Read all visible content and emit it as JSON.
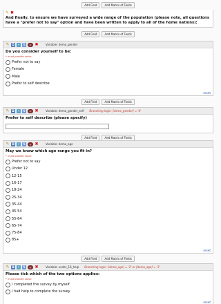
{
  "buttons": {
    "add_field": "Add Field",
    "add_matrix": "Add Matrix of Fields"
  },
  "intro": {
    "text": "And finally, to ensure we have surveyed a wide range of the population (please note, all questions have a \"prefer not to say\" option and have been written to apply to all of the home nations):"
  },
  "required_label": "* must provide value",
  "reset_label": "reset",
  "q_gender": {
    "variable": "Variable: demo_gender",
    "question": "Do you consider yourself to be:",
    "options": [
      "Prefer not to say",
      "Female",
      "Male",
      "Prefer to self describe"
    ]
  },
  "q_gender_self": {
    "variable": "Variable: demo_gender_self",
    "logic": "Branching logic: [demo_gender] = '4'",
    "question": "Prefer to self describe (please specify)"
  },
  "q_age": {
    "variable": "Variable: demo_age",
    "question": "May we know which age range you fit in?",
    "options": [
      "Prefer not to say",
      "Under 12",
      "12-15",
      "16-17",
      "18-24",
      "25-34",
      "35-44",
      "45-54",
      "55-64",
      "65-74",
      "75-84",
      "85+"
    ]
  },
  "q_help": {
    "variable": "Variable: under_16_help",
    "logic": "Branching logic: [demo_age] = '2' or [demo_age] = '3'",
    "question": "Please tick which of the two options applies:",
    "options": [
      "I completed the survey by myself",
      "I had help to complete the survey"
    ]
  },
  "icons": [
    "pencil-icon",
    "copy-icon",
    "branch-icon",
    "move-icon",
    "action-tag-icon",
    "delete-icon"
  ]
}
